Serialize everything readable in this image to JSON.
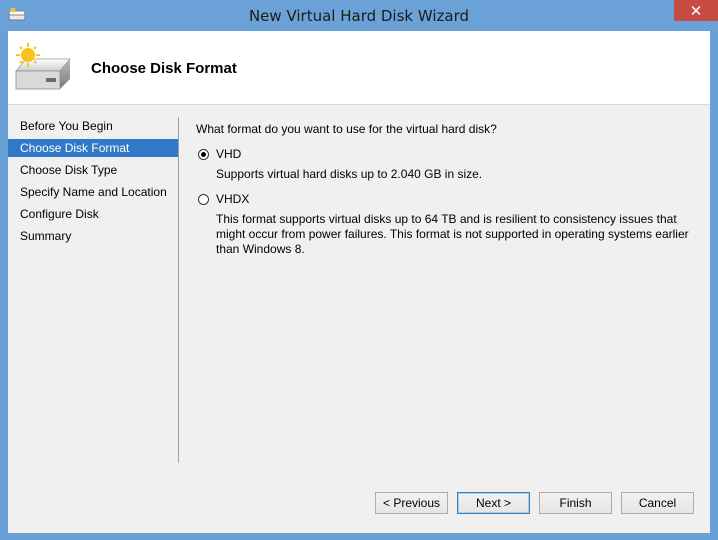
{
  "window": {
    "title": "New Virtual Hard Disk Wizard",
    "close_glyph": "✕"
  },
  "header": {
    "title": "Choose Disk Format",
    "icon": "hard-disk-new-icon"
  },
  "nav": {
    "items": [
      {
        "label": "Before You Begin",
        "active": false
      },
      {
        "label": "Choose Disk Format",
        "active": true
      },
      {
        "label": "Choose Disk Type",
        "active": false
      },
      {
        "label": "Specify Name and Location",
        "active": false
      },
      {
        "label": "Configure Disk",
        "active": false
      },
      {
        "label": "Summary",
        "active": false
      }
    ]
  },
  "content": {
    "question": "What format do you want to use for the virtual hard disk?",
    "options": [
      {
        "label": "VHD",
        "selected": true,
        "description": "Supports virtual hard disks up to 2.040 GB in size."
      },
      {
        "label": "VHDX",
        "selected": false,
        "description": "This format supports virtual disks up to 64 TB and is resilient to consistency issues that might occur from power failures. This format is not supported in operating systems earlier than Windows 8."
      }
    ]
  },
  "buttons": {
    "previous": "< Previous",
    "next": "Next >",
    "finish": "Finish",
    "cancel": "Cancel"
  },
  "colors": {
    "titlebar": "#6aa1d6",
    "close": "#c74a43",
    "selection": "#3079c7",
    "client": "#f0f0f0"
  }
}
